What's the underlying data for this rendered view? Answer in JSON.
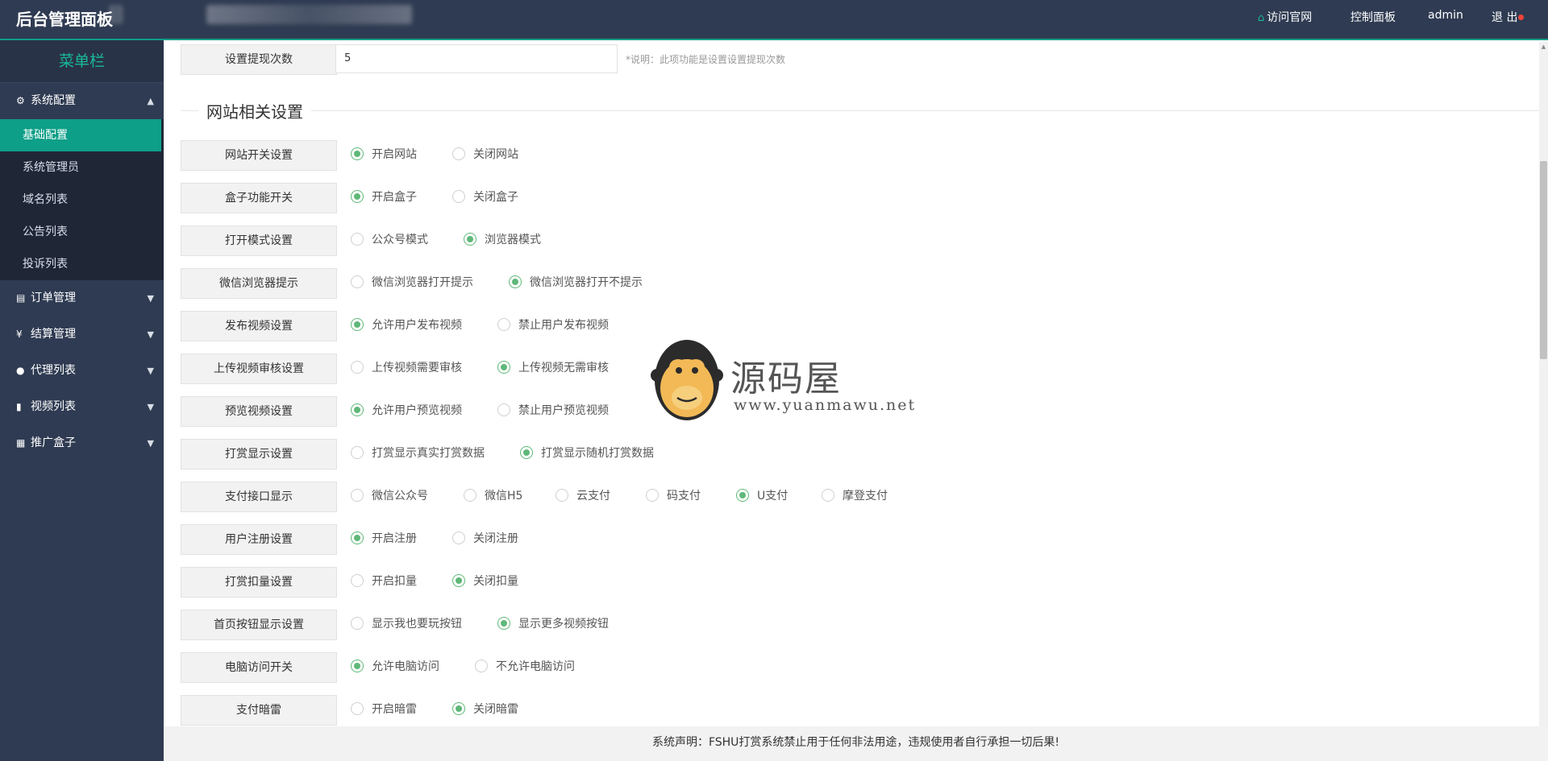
{
  "header": {
    "logo": "后台管理面板",
    "nav": {
      "visit_site": "访问官网",
      "control_panel": "控制面板",
      "user": "admin",
      "logout": "退 出"
    }
  },
  "sidebar": {
    "title": "菜单栏",
    "system_group": "系统配置",
    "sub_items": [
      "基础配置",
      "系统管理员",
      "域名列表",
      "公告列表",
      "投诉列表"
    ],
    "groups": [
      "订单管理",
      "结算管理",
      "代理列表",
      "视频列表",
      "推广盒子"
    ]
  },
  "withdraw": {
    "label": "设置提现次数",
    "value": "5",
    "note": "*说明：此项功能是设置设置提现次数"
  },
  "section_title": "网站相关设置",
  "settings": [
    {
      "label": "网站开关设置",
      "options": [
        "开启网站",
        "关闭网站"
      ],
      "selected": 0
    },
    {
      "label": "盒子功能开关",
      "options": [
        "开启盒子",
        "关闭盒子"
      ],
      "selected": 0
    },
    {
      "label": "打开模式设置",
      "options": [
        "公众号模式",
        "浏览器模式"
      ],
      "selected": 1
    },
    {
      "label": "微信浏览器提示",
      "options": [
        "微信浏览器打开提示",
        "微信浏览器打开不提示"
      ],
      "selected": 1
    },
    {
      "label": "发布视频设置",
      "options": [
        "允许用户发布视频",
        "禁止用户发布视频"
      ],
      "selected": 0
    },
    {
      "label": "上传视频审核设置",
      "options": [
        "上传视频需要审核",
        "上传视频无需审核"
      ],
      "selected": 1
    },
    {
      "label": "预览视频设置",
      "options": [
        "允许用户预览视频",
        "禁止用户预览视频"
      ],
      "selected": 0
    },
    {
      "label": "打赏显示设置",
      "options": [
        "打赏显示真实打赏数据",
        "打赏显示随机打赏数据"
      ],
      "selected": 1
    },
    {
      "label": "支付接口显示",
      "options": [
        "微信公众号",
        "微信H5",
        "云支付",
        "码支付",
        "U支付",
        "摩登支付"
      ],
      "selected": 4
    },
    {
      "label": "用户注册设置",
      "options": [
        "开启注册",
        "关闭注册"
      ],
      "selected": 0
    },
    {
      "label": "打赏扣量设置",
      "options": [
        "开启扣量",
        "关闭扣量"
      ],
      "selected": 1
    },
    {
      "label": "首页按钮显示设置",
      "options": [
        "显示我也要玩按钮",
        "显示更多视频按钮"
      ],
      "selected": 1
    },
    {
      "label": "电脑访问开关",
      "options": [
        "允许电脑访问",
        "不允许电脑访问"
      ],
      "selected": 0
    },
    {
      "label": "支付暗雷",
      "options": [
        "开启暗雷",
        "关闭暗雷"
      ],
      "selected": 1
    }
  ],
  "watermark": {
    "name": "源码屋",
    "url": "www.yuanmawu.net"
  },
  "footer": "系统声明：FSHU打赏系统禁止用于任何非法用途，违规使用者自行承担一切后果!",
  "colors": {
    "header_bg": "#2f3b52",
    "accent": "#0d9f88",
    "radio_on": "#5fb878"
  }
}
